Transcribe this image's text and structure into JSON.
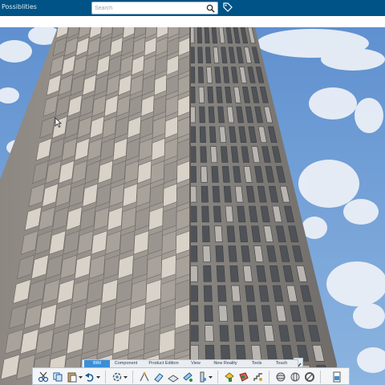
{
  "header": {
    "app_title": "Possiblities",
    "search_placeholder": "Search"
  },
  "toolbar": {
    "tabs": [
      "BIM",
      "Component",
      "Product Edition",
      "View",
      "New Reality",
      "Tools",
      "Touch"
    ],
    "active_tab": "BIM"
  },
  "colors": {
    "header_bg": "#005386",
    "active_tab": "#3b8fd6",
    "sky": "#7aa6d8",
    "facade": "#9a9590"
  }
}
